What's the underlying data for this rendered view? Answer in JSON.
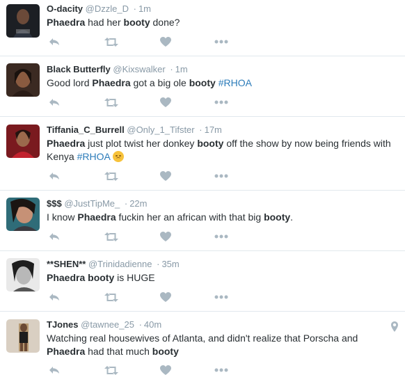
{
  "tweets": [
    {
      "name": "O-dacity",
      "handle": "@Dzzle_D",
      "time": "1m",
      "segments": [
        {
          "t": "Phaedra",
          "b": true
        },
        {
          "t": " had her "
        },
        {
          "t": "booty",
          "b": true
        },
        {
          "t": " done?"
        }
      ]
    },
    {
      "name": "Black Butterfly",
      "handle": "@Kixswalker",
      "time": "1m",
      "segments": [
        {
          "t": "Good lord "
        },
        {
          "t": "Phaedra",
          "b": true
        },
        {
          "t": " got a big ole "
        },
        {
          "t": "booty",
          "b": true
        },
        {
          "t": " "
        },
        {
          "t": "#RHOA",
          "tag": true
        }
      ]
    },
    {
      "name": "Tiffania_C_Burrell",
      "handle": "@Only_1_Tifster",
      "time": "17m",
      "segments": [
        {
          "t": "Phaedra",
          "b": true
        },
        {
          "t": " just plot twist her donkey "
        },
        {
          "t": "booty",
          "b": true
        },
        {
          "t": " off the show by now being friends with Kenya "
        },
        {
          "t": "#RHOA",
          "tag": true
        },
        {
          "t": " "
        },
        {
          "emoji": "disappointed-face"
        }
      ]
    },
    {
      "name": "$$$",
      "handle": "@JustTipMe_",
      "time": "22m",
      "segments": [
        {
          "t": "I know "
        },
        {
          "t": "Phaedra",
          "b": true
        },
        {
          "t": " fuckin her an african with that big "
        },
        {
          "t": "booty",
          "b": true
        },
        {
          "t": "."
        }
      ]
    },
    {
      "name": "**SHEN**",
      "handle": "@Trinidadienne",
      "time": "35m",
      "segments": [
        {
          "t": "Phaedra",
          "b": true
        },
        {
          "t": " "
        },
        {
          "t": "booty",
          "b": true
        },
        {
          "t": " is HUGE"
        }
      ]
    },
    {
      "name": "TJones",
      "handle": "@tawnee_25",
      "time": "40m",
      "geo": true,
      "segments": [
        {
          "t": "Watching real housewives of Atlanta, and didn't realize that Porscha and "
        },
        {
          "t": "Phaedra",
          "b": true
        },
        {
          "t": " had that much "
        },
        {
          "t": "booty",
          "b": true
        }
      ]
    }
  ],
  "separator": "·",
  "icons": {
    "reply": "reply-icon",
    "retweet": "retweet-icon",
    "like": "heart-icon",
    "more": "more-icon",
    "location": "location-pin-icon"
  },
  "colors": {
    "hashtag": "#2b7bb9",
    "meta": "#8899a6",
    "icon": "#aab8c2",
    "divider": "#e1e8ed"
  }
}
